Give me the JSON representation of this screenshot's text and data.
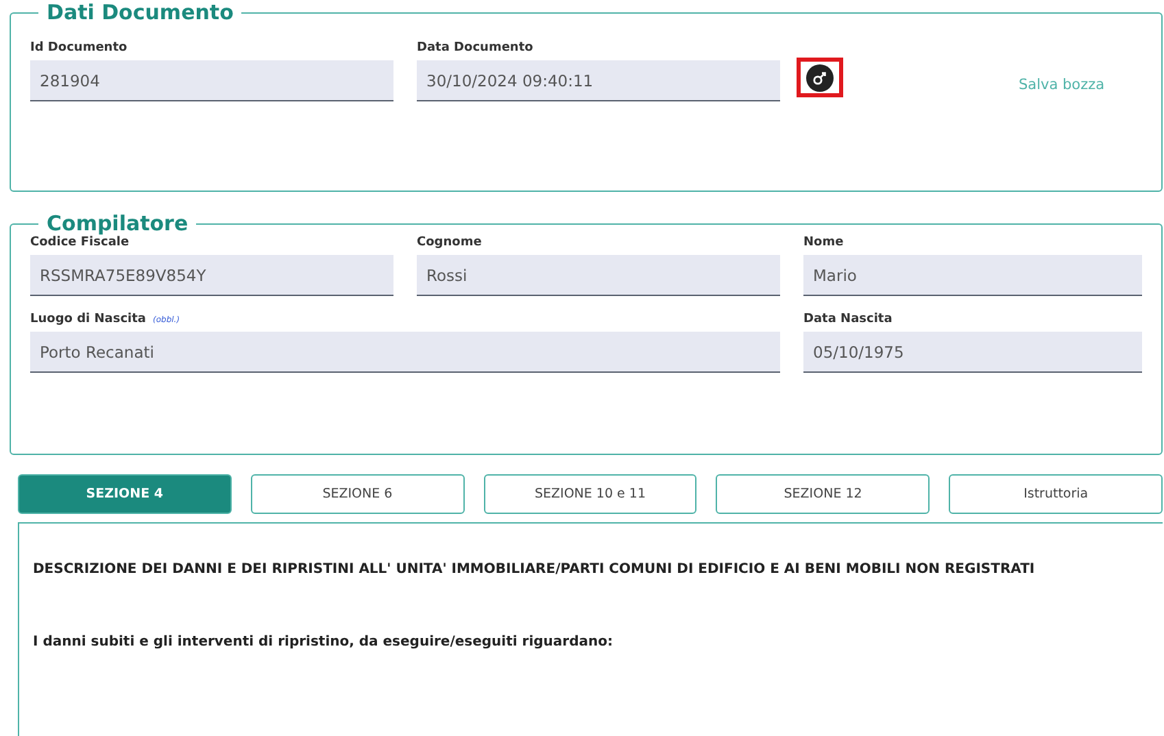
{
  "sections": [
    {
      "title": "Dati Documento",
      "kind": "document",
      "fields": [
        {
          "label": "Id Documento",
          "value": "281904"
        },
        {
          "label": "Data Documento",
          "value": "30/10/2024 09:40:11"
        }
      ],
      "action_button": {
        "highlighted": true
      },
      "link": "Salva bozza"
    },
    {
      "title": "Compilatore",
      "kind": "person",
      "fields": [
        {
          "label": "Codice Fiscale",
          "value": "RSSMRA75E89V854Y"
        },
        {
          "label": "Cognome",
          "value": "Rossi"
        },
        {
          "label": "Nome",
          "value": "Mario"
        },
        {
          "label": "Luogo di Nascita",
          "hint": "(obbl.)",
          "value": "Porto Recanati"
        },
        {
          "label": "Data Nascita",
          "value": "05/10/1975"
        }
      ]
    }
  ],
  "tabs": [
    {
      "label": "SEZIONE 4",
      "selected": true
    },
    {
      "label": "SEZIONE 6",
      "selected": false
    },
    {
      "label": "SEZIONE 10 e 11",
      "selected": false
    },
    {
      "label": "SEZIONE 12",
      "selected": false
    },
    {
      "label": "Istruttoria",
      "selected": false
    }
  ],
  "content": {
    "heading": "DESCRIZIONE DEI DANNI E DEI RIPRISTINI ALL' UNITA' IMMOBILIARE/PARTI COMUNI DI EDIFICIO E AI BENI MOBILI NON REGISTRATI",
    "subheading": "I danni subiti e gli interventi di ripristino, da eseguire/eseguiti riguardano:"
  }
}
